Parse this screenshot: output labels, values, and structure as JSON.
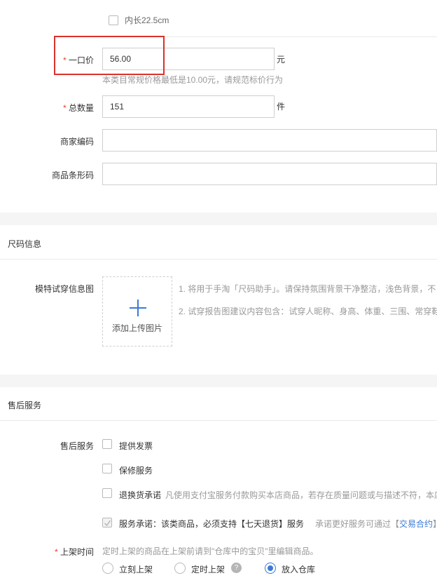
{
  "top_option": {
    "label": "内长22.5cm"
  },
  "price": {
    "label": "一口价",
    "required_mark": "*",
    "value": "56.00",
    "unit": "元",
    "hint": "本类目常规价格最低是10.00元，请规范标价行为"
  },
  "quantity": {
    "label": "总数量",
    "required_mark": "*",
    "value": "151",
    "unit": "件"
  },
  "merchant_code": {
    "label": "商家编码",
    "value": ""
  },
  "barcode": {
    "label": "商品条形码",
    "value": ""
  },
  "size_section": {
    "title": "尺码信息",
    "model_label": "模特试穿信息图",
    "upload_label": "添加上传图片",
    "notes": [
      "1. 将用于手淘「尺码助手」。请保持氛围背景干净整洁，浅色背景，不",
      "2. 试穿报告图建议内容包含：试穿人昵称、身高、体重、三围、常穿鞋"
    ]
  },
  "after_sales_section": {
    "title": "售后服务",
    "label": "售后服务",
    "options": [
      {
        "label": "提供发票",
        "checked": false
      },
      {
        "label": "保修服务",
        "checked": false
      },
      {
        "label": "退换货承诺",
        "desc": "凡使用支付宝服务付款购买本店商品，若存在质量问题或与描述不符，本店",
        "checked": false
      }
    ],
    "commitment": {
      "label": "服务承诺：该类商品，必须支持【七天退货】服务",
      "note_prefix": "承诺更好服务可通过【",
      "link": "交易合约",
      "note_suffix": "】"
    }
  },
  "listing": {
    "label": "上架时间",
    "required_mark": "*",
    "hint": "定时上架的商品在上架前请到\"仓库中的宝贝\"里编辑商品。",
    "options": [
      {
        "label": "立刻上架",
        "selected": false
      },
      {
        "label": "定时上架",
        "selected": false,
        "has_help": true
      },
      {
        "label": "放入仓库",
        "selected": true
      }
    ],
    "help_glyph": "?"
  },
  "colors": {
    "required": "#e8412c",
    "accent": "#3a7bd5",
    "highlight_box": "#d9322c",
    "section_band": "#f5f5f5"
  }
}
